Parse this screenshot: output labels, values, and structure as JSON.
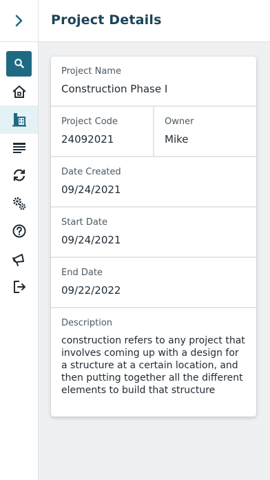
{
  "header": {
    "title": "Project Details"
  },
  "sidebar": {
    "items": [
      {
        "name": "search",
        "icon": "search-icon"
      },
      {
        "name": "home",
        "icon": "home-icon"
      },
      {
        "name": "projects",
        "icon": "buildings-icon"
      },
      {
        "name": "list",
        "icon": "list-icon"
      },
      {
        "name": "sync",
        "icon": "sync-icon"
      },
      {
        "name": "settings",
        "icon": "gears-icon"
      },
      {
        "name": "help",
        "icon": "help-icon"
      },
      {
        "name": "announcements",
        "icon": "megaphone-icon"
      },
      {
        "name": "logout",
        "icon": "logout-icon"
      }
    ]
  },
  "project": {
    "name_label": "Project Name",
    "name": "Construction Phase I",
    "code_label": "Project Code",
    "code": "24092021",
    "owner_label": "Owner",
    "owner": "Mike",
    "date_created_label": "Date Created",
    "date_created": "09/24/2021",
    "start_date_label": "Start Date",
    "start_date": "09/24/2021",
    "end_date_label": "End Date",
    "end_date": "09/22/2022",
    "description_label": "Description",
    "description": "construction refers to any project that involves coming up with a design for a structure at a certain location, and then putting together all the different elements to build that structure"
  },
  "colors": {
    "accent": "#1f6a83",
    "title": "#1c4356",
    "active_bg": "#e4f1f5"
  }
}
